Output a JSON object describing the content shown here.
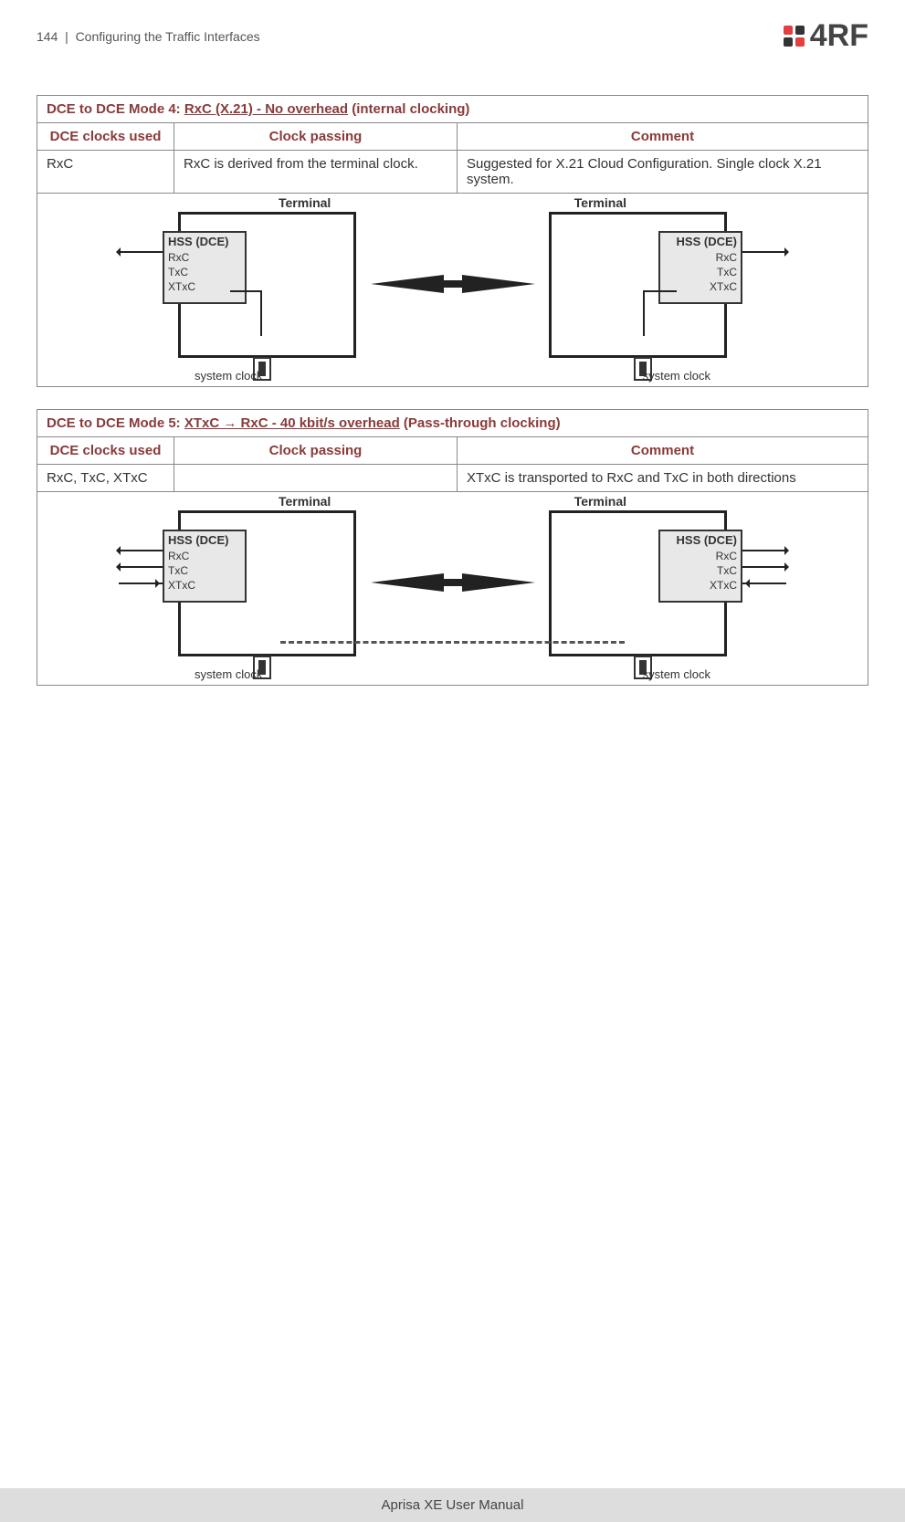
{
  "header": {
    "page_number": "144",
    "separator": "|",
    "section_title": "Configuring the Traffic Interfaces",
    "logo_text": "4RF",
    "logo_name": "4rf-logo"
  },
  "table4": {
    "title_prefix": "DCE to DCE Mode 4:  ",
    "title_underline": "RxC (X.21) - No overhead",
    "title_suffix": " (internal clocking)",
    "col1": "DCE clocks used",
    "col2": "Clock passing",
    "col3": "Comment",
    "r1c1": "RxC",
    "r1c2": "RxC is derived from the terminal clock.",
    "r1c3": "Suggested for X.21 Cloud Configuration. Single clock X.21 system.",
    "diagram": {
      "terminal": "Terminal",
      "hss": "HSS (DCE)",
      "rxc": "RxC",
      "txc": "TxC",
      "xtxc": "XTxC",
      "system_clock": "system clock"
    }
  },
  "table5": {
    "title_prefix": "DCE to DCE Mode 5:  ",
    "title_underline": "XTxC → RxC - 40 kbit/s overhead",
    "title_suffix": " (Pass-through clocking)",
    "col1": "DCE clocks used",
    "col2": "Clock passing",
    "col3": "Comment",
    "r1c1": "RxC, TxC, XTxC",
    "r1c2": "",
    "r1c3": "XTxC is transported to RxC and TxC in both directions",
    "diagram": {
      "terminal": "Terminal",
      "hss": "HSS (DCE)",
      "rxc": "RxC",
      "txc": "TxC",
      "xtxc": "XTxC",
      "system_clock": "system clock"
    }
  },
  "footer": {
    "manual_title": "Aprisa XE User Manual"
  }
}
